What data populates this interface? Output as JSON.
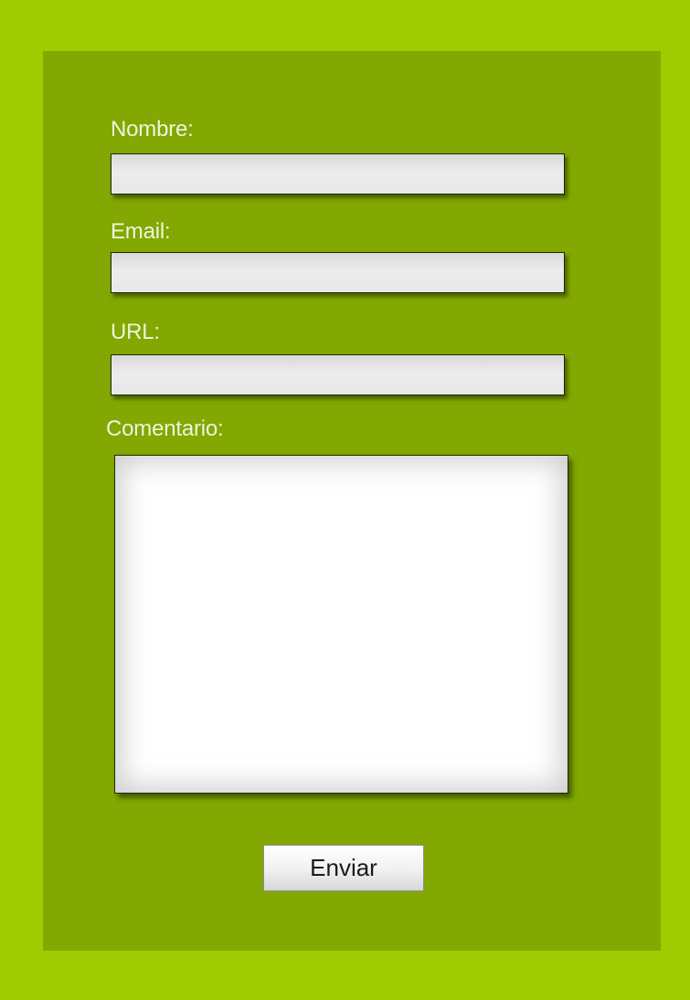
{
  "form": {
    "fields": [
      {
        "label": "Nombre:",
        "value": "",
        "placeholder": ""
      },
      {
        "label": "Email:",
        "value": "",
        "placeholder": ""
      },
      {
        "label": "URL:",
        "value": "",
        "placeholder": ""
      }
    ],
    "comment": {
      "label": "Comentario:",
      "value": "",
      "placeholder": ""
    },
    "submit_label": "Enviar"
  },
  "colors": {
    "page_background": "#9fcb00",
    "panel_background": "#82a801",
    "label_text": "#eef5dc"
  }
}
